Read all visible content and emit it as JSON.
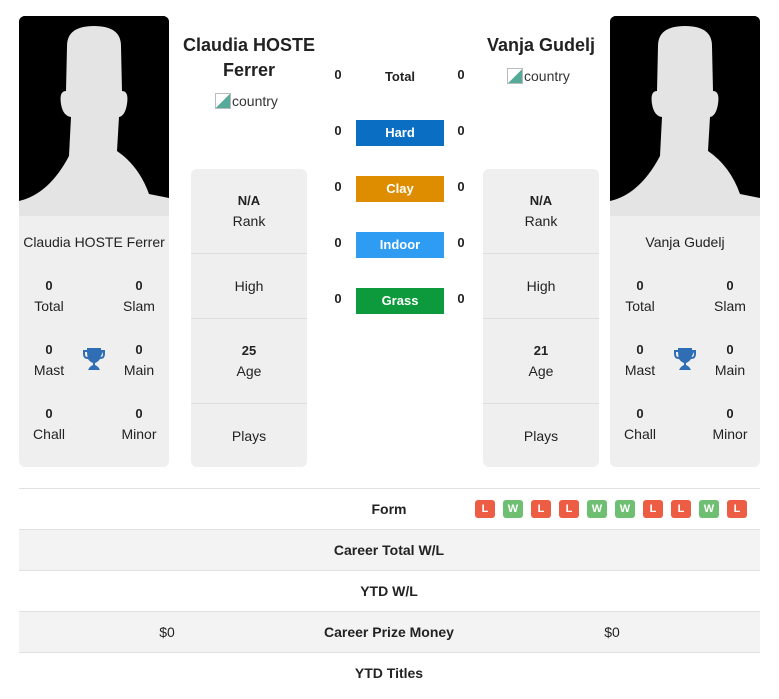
{
  "player1": {
    "name": "Claudia HOSTE Ferrer",
    "flag_alt": "country",
    "titles": {
      "total": "0",
      "slam": "0",
      "mast": "0",
      "main": "0",
      "chall": "0",
      "minor": "0"
    },
    "rank": "N/A",
    "high": "",
    "age": "25",
    "plays": ""
  },
  "player2": {
    "name": "Vanja Gudelj",
    "flag_alt": "country",
    "titles": {
      "total": "0",
      "slam": "0",
      "mast": "0",
      "main": "0",
      "chall": "0",
      "minor": "0"
    },
    "rank": "N/A",
    "high": "",
    "age": "21",
    "plays": ""
  },
  "labels": {
    "total": "Total",
    "slam": "Slam",
    "mast": "Mast",
    "main": "Main",
    "chall": "Chall",
    "minor": "Minor",
    "rank": "Rank",
    "high": "High",
    "age": "Age",
    "plays": "Plays"
  },
  "h2h": {
    "total": {
      "label": "Total",
      "p1": "0",
      "p2": "0"
    },
    "surfaces": [
      {
        "label": "Hard",
        "p1": "0",
        "p2": "0",
        "color": "#0a6fc2"
      },
      {
        "label": "Clay",
        "p1": "0",
        "p2": "0",
        "color": "#de8c00"
      },
      {
        "label": "Indoor",
        "p1": "0",
        "p2": "0",
        "color": "#2d9cf2"
      },
      {
        "label": "Grass",
        "p1": "0",
        "p2": "0",
        "color": "#0d9a3c"
      }
    ]
  },
  "bottom": {
    "form_label": "Form",
    "form": [
      "L",
      "W",
      "L",
      "L",
      "W",
      "W",
      "L",
      "L",
      "W",
      "L"
    ],
    "form_colors": {
      "W": "#6fbf73",
      "L": "#ec5d43"
    },
    "rows": [
      {
        "label": "Career Total W/L",
        "p1": "",
        "p2": ""
      },
      {
        "label": "YTD W/L",
        "p1": "",
        "p2": ""
      },
      {
        "label": "Career Prize Money",
        "p1": "$0",
        "p2": "$0"
      },
      {
        "label": "YTD Titles",
        "p1": "",
        "p2": ""
      }
    ]
  }
}
